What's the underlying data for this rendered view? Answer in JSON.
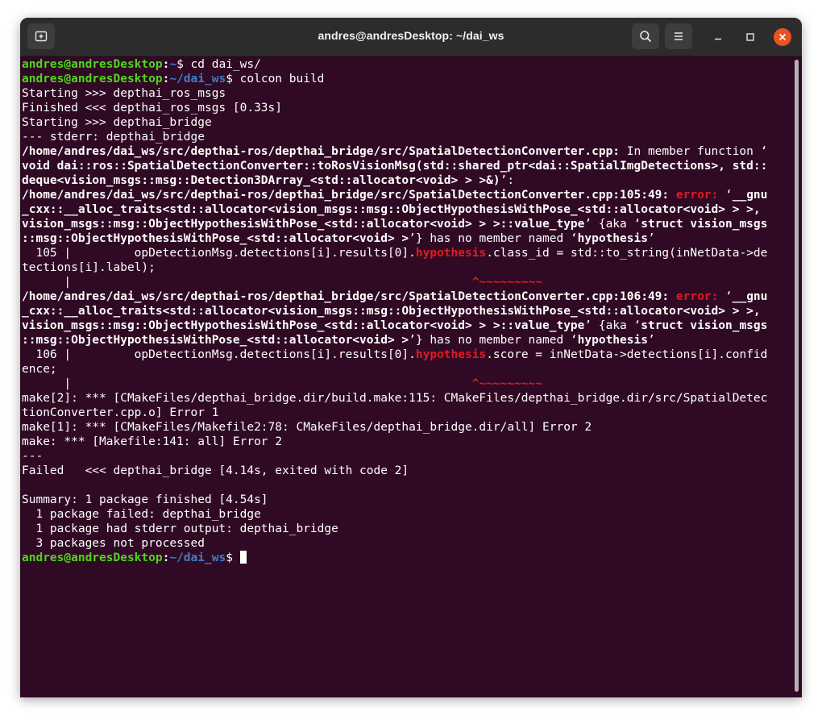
{
  "window": {
    "title": "andres@andresDesktop: ~/dai_ws"
  },
  "prompt": {
    "user_host": "andres@andresDesktop",
    "colon": ":",
    "home_path": "~",
    "ws_path": "~/dai_ws",
    "symbol": "$ "
  },
  "commands": {
    "cmd1": "cd dai_ws/",
    "cmd2": "colcon build"
  },
  "lines": {
    "l3": "Starting >>> depthai_ros_msgs",
    "l4": "Finished <<< depthai_ros_msgs [0.33s]",
    "l5": "Starting >>> depthai_bridge",
    "l6": "--- stderr: depthai_bridge",
    "l7a": "/home/andres/dai_ws/src/depthai-ros/depthai_bridge/src/SpatialDetectionConverter.cpp:",
    "l7b": " In member function ‘",
    "l8": "void dai::ros::SpatialDetectionConverter::toRosVisionMsg(std::shared_ptr<dai::SpatialImgDetections>, std::",
    "l9a": "deque<vision_msgs::msg::Detection3DArray_<std::allocator<void> > >&)",
    "l9b": "’:",
    "l10a": "/home/andres/dai_ws/src/depthai-ros/depthai_bridge/src/SpatialDetectionConverter.cpp:105:49:",
    "l10b": " ",
    "l10c": "error:",
    "l10d": " ‘",
    "l10e": "__gnu",
    "l11": "_cxx::__alloc_traits<std::allocator<vision_msgs::msg::ObjectHypothesisWithPose_<std::allocator<void> > >,",
    "l12a": "vision_msgs::msg::ObjectHypothesisWithPose_<std::allocator<void> > >::value_type",
    "l12b": "’ {aka ‘",
    "l12c": "struct vision_msgs",
    "l13a": "::msg::ObjectHypothesisWithPose_<std::allocator<void> >",
    "l13b": "’} has no member named ‘",
    "l13c": "hypothesis",
    "l13d": "’",
    "l14a": "  105 |         opDetectionMsg.detections[i].results[0].",
    "l14b": "hypothesis",
    "l14c": ".class_id = std::to_string(inNetData->de",
    "l15": "tections[i].label);",
    "l16a": "      |                                                         ",
    "l16b": "^~~~~~~~~~",
    "l17a": "/home/andres/dai_ws/src/depthai-ros/depthai_bridge/src/SpatialDetectionConverter.cpp:106:49:",
    "l17b": " ",
    "l17c": "error:",
    "l17d": " ‘",
    "l17e": "__gnu",
    "l18": "_cxx::__alloc_traits<std::allocator<vision_msgs::msg::ObjectHypothesisWithPose_<std::allocator<void> > >,",
    "l19a": "vision_msgs::msg::ObjectHypothesisWithPose_<std::allocator<void> > >::value_type",
    "l19b": "’ {aka ‘",
    "l19c": "struct vision_msgs",
    "l20a": "::msg::ObjectHypothesisWithPose_<std::allocator<void> >",
    "l20b": "’} has no member named ‘",
    "l20c": "hypothesis",
    "l20d": "’",
    "l21a": "  106 |         opDetectionMsg.detections[i].results[0].",
    "l21b": "hypothesis",
    "l21c": ".score = inNetData->detections[i].confid",
    "l22": "ence;",
    "l23a": "      |                                                         ",
    "l23b": "^~~~~~~~~~",
    "l24": "make[2]: *** [CMakeFiles/depthai_bridge.dir/build.make:115: CMakeFiles/depthai_bridge.dir/src/SpatialDetec",
    "l25": "tionConverter.cpp.o] Error 1",
    "l26": "make[1]: *** [CMakeFiles/Makefile2:78: CMakeFiles/depthai_bridge.dir/all] Error 2",
    "l27": "make: *** [Makefile:141: all] Error 2",
    "l28": "---",
    "l29": "Failed   <<< depthai_bridge [4.14s, exited with code 2]",
    "l30": "",
    "l31": "Summary: 1 package finished [4.54s]",
    "l32": "  1 package failed: depthai_bridge",
    "l33": "  1 package had stderr output: depthai_bridge",
    "l34": "  3 packages not processed"
  },
  "colors": {
    "background": "#300a24",
    "prompt_user": "#4fd61e",
    "prompt_path": "#3d7ec9",
    "error": "#e01b24",
    "close": "#e95420"
  },
  "icons": {
    "new_tab": "new-tab-icon",
    "search": "search-icon",
    "menu": "hamburger-menu-icon",
    "minimize": "minimize-icon",
    "maximize": "maximize-icon",
    "close": "close-icon"
  }
}
